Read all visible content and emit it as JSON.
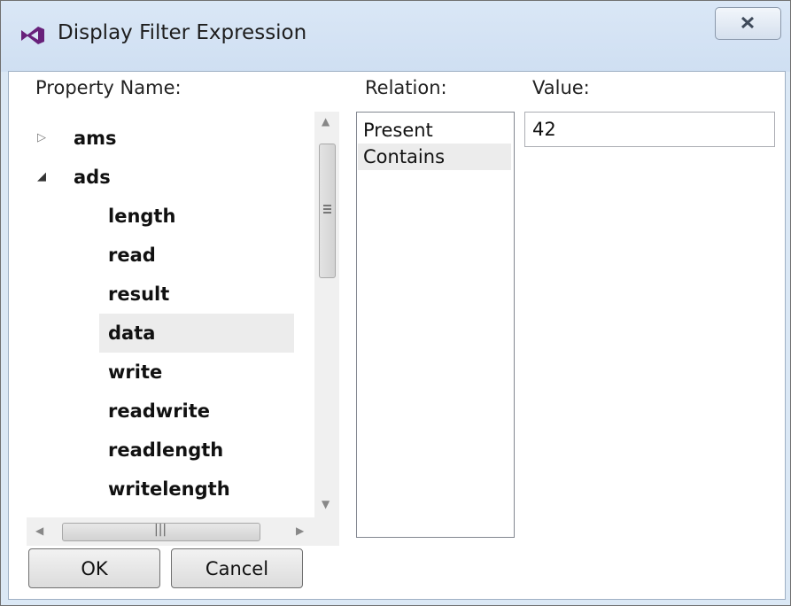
{
  "window": {
    "title": "Display Filter Expression",
    "accent_color": "#68217a"
  },
  "labels": {
    "property_name": "Property Name:",
    "relation": "Relation:",
    "value": "Value:"
  },
  "tree": {
    "items": [
      {
        "label": "ams",
        "level": 0,
        "expander": "collapsed"
      },
      {
        "label": "ads",
        "level": 0,
        "expander": "expanded"
      },
      {
        "label": "length",
        "level": 1
      },
      {
        "label": "read",
        "level": 1
      },
      {
        "label": "result",
        "level": 1
      },
      {
        "label": "data",
        "level": 1,
        "selected": true
      },
      {
        "label": "write",
        "level": 1
      },
      {
        "label": "readwrite",
        "level": 1
      },
      {
        "label": "readlength",
        "level": 1
      },
      {
        "label": "writelength",
        "level": 1
      }
    ]
  },
  "relation": {
    "items": [
      {
        "label": "Present",
        "selected": false
      },
      {
        "label": "Contains",
        "selected": true
      }
    ]
  },
  "value": {
    "text": "42"
  },
  "buttons": {
    "ok": "OK",
    "cancel": "Cancel"
  }
}
